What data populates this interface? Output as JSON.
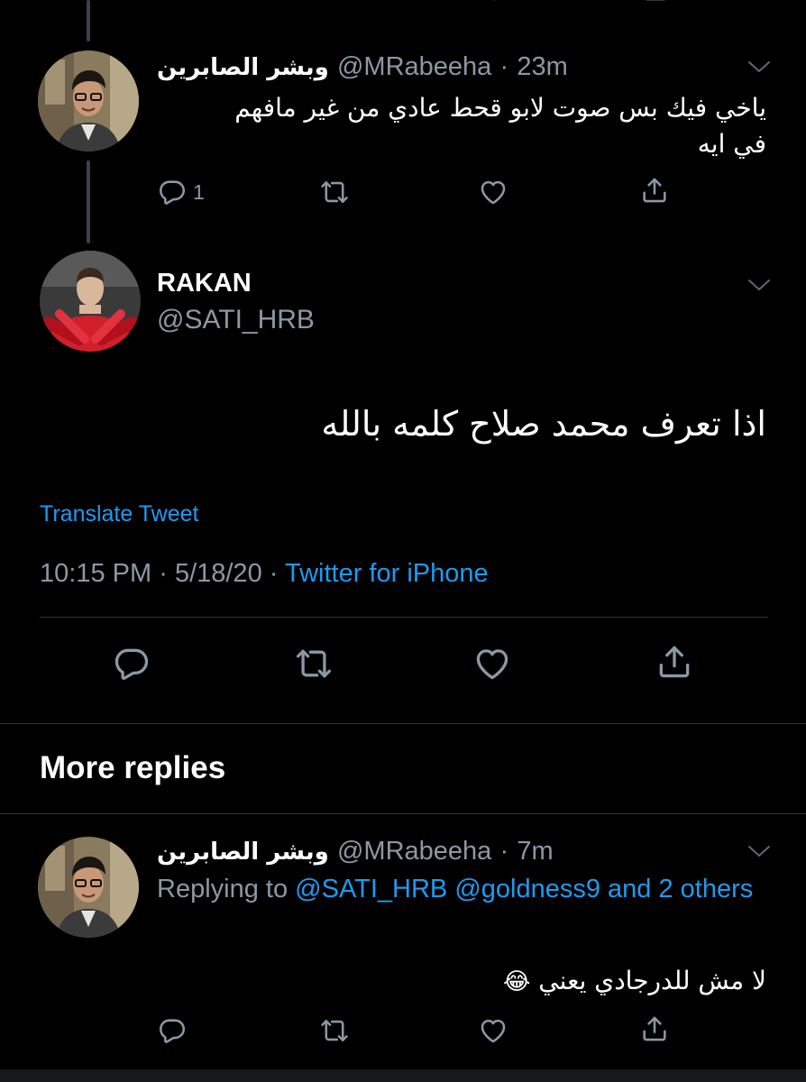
{
  "top_partial_actions": {
    "note": ""
  },
  "reply1": {
    "display_name": "وبشر الصابرين",
    "handle": "@MRabeeha",
    "separator": "·",
    "time": "23m",
    "text_line1": "ياخي فيك بس صوت لابو قحط عادي من غير مافهم",
    "text_line2": "في ايه",
    "reply_count": "1"
  },
  "main_tweet": {
    "display_name": "RAKAN",
    "handle": "@SATI_HRB",
    "text": "اذا تعرف محمد صلاح كلمه بالله",
    "translate_label": "Translate Tweet",
    "time": "10:15 PM",
    "sep1": "·",
    "date": "5/18/20",
    "sep2": "·",
    "source": "Twitter for iPhone"
  },
  "more_replies": {
    "heading": "More replies"
  },
  "reply2": {
    "display_name": "وبشر الصابرين",
    "handle": "@MRabeeha",
    "separator": "·",
    "time": "7m",
    "replying_prefix": "Replying to",
    "mention1": "@SATI_HRB",
    "mention2": "@goldness9",
    "and_others": "and 2 others",
    "text": "لا مش للدرجادي يعني",
    "emoji": "😂"
  },
  "icons": {
    "reply": "reply-icon",
    "retweet": "retweet-icon",
    "like": "like-icon",
    "share": "share-icon",
    "more": "chevron-down-icon"
  },
  "colors": {
    "background": "#000000",
    "secondary_text": "#8b98a5",
    "link": "#1d9bf0",
    "divider": "#2f3336"
  }
}
